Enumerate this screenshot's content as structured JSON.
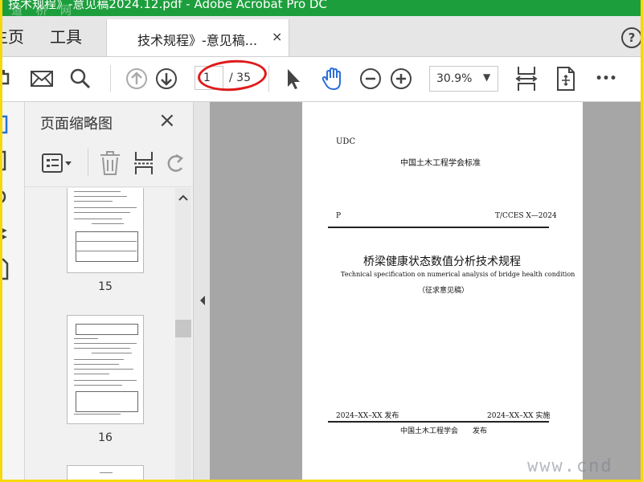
{
  "titlebar": {
    "title": "技术规程》-意见稿2024.12.pdf - Adobe Acrobat Pro DC",
    "watermark": "道 桥 网"
  },
  "menubar": {
    "home": "主页",
    "tools": "工具",
    "doc_tab": "技术规程》-意见稿...",
    "close_tab": "×",
    "help": "?"
  },
  "toolbar": {
    "page_current": "1",
    "page_total": "/ 35",
    "zoom": "30.9%",
    "zoom_caret": "▼",
    "more": "•••"
  },
  "panel": {
    "title": "页面缩略图",
    "close": "×",
    "thumbnails": [
      {
        "number": "15"
      },
      {
        "number": "16"
      }
    ]
  },
  "document": {
    "udc": "UDC",
    "org_standard": "中国土木工程学会标准",
    "p_label": "P",
    "code": "T/CCES X—2024",
    "title_cn": "桥梁健康状态数值分析技术规程",
    "title_en": "Technical specification on numerical analysis of bridge health condition",
    "draft_note": "（征求意见稿）",
    "publish": "2024–XX–XX 发布",
    "implement": "2024–XX–XX 实施",
    "issuer": "中国土木工程学会　　发布"
  },
  "watermark_site": "www.cnd",
  "colors": {
    "title_bar": "#1d9e3c",
    "frame": "#f5d90a",
    "annotation": "#e01a1a"
  }
}
